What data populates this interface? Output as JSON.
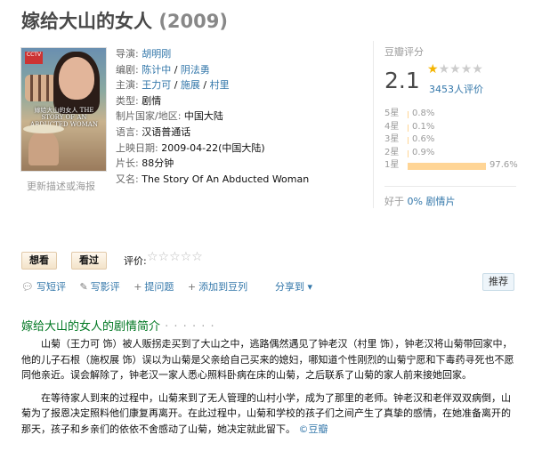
{
  "title": {
    "name": "嫁给大山的女人",
    "year": "(2009)"
  },
  "poster": {
    "badge": "CCTV",
    "text": "嫁给大山的女人 THE STORY OF AN ABDUCTED WOMAN"
  },
  "update_link": "更新描述或海报",
  "info": {
    "director_k": "导演:",
    "director": "胡明刚",
    "writer_k": "编剧:",
    "writer_1": "陈计中",
    "writer_sep": " / ",
    "writer_2": "阴法勇",
    "cast_k": "主演:",
    "cast_1": "王力可",
    "cast_sep1": " / ",
    "cast_2": "施展",
    "cast_sep2": " / ",
    "cast_3": "村里",
    "genre_k": "类型:",
    "genre": "剧情",
    "country_k": "制片国家/地区:",
    "country": "中国大陆",
    "lang_k": "语言:",
    "lang": "汉语普通话",
    "date_k": "上映日期:",
    "date": "2009-04-22(中国大陆)",
    "length_k": "片长:",
    "length": "88分钟",
    "aka_k": "又名:",
    "aka": "The Story Of An Abducted Woman"
  },
  "rating": {
    "label": "豆瓣评分",
    "score": "2.1",
    "stars_filled": 1,
    "votes": "3453人评价",
    "distribution": [
      {
        "star": "5星",
        "pct": "0.8%",
        "fraction": 0.008
      },
      {
        "star": "4星",
        "pct": "0.1%",
        "fraction": 0.001
      },
      {
        "star": "3星",
        "pct": "0.6%",
        "fraction": 0.006
      },
      {
        "star": "2星",
        "pct": "0.9%",
        "fraction": 0.009
      },
      {
        "star": "1星",
        "pct": "97.6%",
        "fraction": 0.976
      }
    ],
    "better_than_prefix": "好于 ",
    "better_than_link": "0% 剧情片"
  },
  "actions": {
    "want": "想看",
    "seen": "看过",
    "rate_label": "评价:",
    "rate_stars": "☆☆☆☆☆"
  },
  "tools": {
    "short_review": "写短评",
    "review": "写影评",
    "ask": "提问题",
    "add_list": "添加到豆列",
    "share": "分享到",
    "recommend": "推荐"
  },
  "summary": {
    "title": "嫁给大山的女人的剧情简介",
    "dots": " · · · · · ·",
    "p1": "山菊（王力可 饰）被人贩拐走买到了大山之中，逃路偶然遇见了钟老汉（村里 饰），钟老汉将山菊带回家中，他的儿子石根（施权展 饰）误以为山菊是父亲给自己买来的媳妇，哪知道个性刚烈的山菊宁愿和下毒药寻死也不愿同他亲近。误会解除了，钟老汉一家人悉心照料卧病在床的山菊，之后联系了山菊的家人前来接她回家。",
    "p2": "在等待家人到来的过程中，山菊来到了无人管理的山村小学，成为了那里的老师。钟老汉和老伴双双病倒，山菊为了报恩决定照料他们康复再离开。在此过程中，山菊和学校的孩子们之间产生了真挚的感情，在她准备离开的那天，孩子和乡亲们的依依不舍感动了山菊，她决定就此留下。",
    "source": "©豆瓣"
  },
  "colors": {
    "link": "#3377aa",
    "green": "#007722",
    "bar": "#ffd596",
    "star": "#f4b400"
  }
}
